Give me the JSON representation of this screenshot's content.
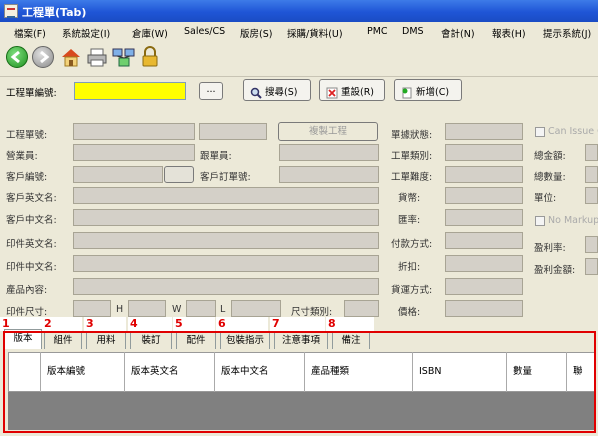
{
  "window": {
    "title": "工程單(Tab)"
  },
  "menu": [
    "檔案(F)",
    "系統設定(I)",
    "倉庫(W)",
    "Sales/CS",
    "版房(S)",
    "採購/貨料(U)",
    "PMC",
    "DMS",
    "會計(N)",
    "報表(H)",
    "提示系統(J)"
  ],
  "toolbar": {
    "icons": [
      "back-icon",
      "forward-icon",
      "home-icon",
      "print-icon",
      "network-icon",
      "lock-icon"
    ]
  },
  "search": {
    "label": "工程單編號:",
    "value": "",
    "browse_label": "...",
    "search_button": "搜尋(S)",
    "reset_button": "重設(R)",
    "new_button": "新增(C)"
  },
  "form": {
    "job_no_label": "工程單號:",
    "copy_job_button": "複製工程",
    "sales_label": "營業員:",
    "follower_label": "跟單員:",
    "customer_code_label": "客戶編號:",
    "customer_order_label": "客戶訂單號:",
    "customer_en_label": "客戶英文名:",
    "customer_cn_label": "客戶中文名:",
    "print_en_label": "印件英文名:",
    "print_cn_label": "印件中文名:",
    "product_content_label": "產品內容:",
    "print_size_label": "印件尺寸:",
    "size_h": "H",
    "size_w": "W",
    "size_l": "L",
    "size_type_label": "尺寸類別:",
    "order_status_label": "單據狀態:",
    "job_type_label": "工單類別:",
    "job_difficulty_label": "工單難度:",
    "currency_label": "貨幣:",
    "exchange_rate_label": "匯率:",
    "payment_label": "付款方式:",
    "discount_label": "折扣:",
    "delivery_label": "貨運方式:",
    "price_label": "價格:",
    "can_issue_label": "Can Issue C",
    "total_amount_label": "總金額:",
    "total_qty_label": "總數量:",
    "unit_label": "單位:",
    "no_markup_label": "No Markup",
    "profit_rate_label": "盈利率:",
    "profit_amount_label": "盈利金額:"
  },
  "tabs": [
    "版本",
    "組件",
    "用料",
    "裝訂",
    "配件",
    "包裝指示",
    "注意事項",
    "備注"
  ],
  "tab_numbers": [
    "1",
    "2",
    "3",
    "4",
    "5",
    "6",
    "7",
    "8"
  ],
  "grid": {
    "columns": [
      "版本編號",
      "版本英文名",
      "版本中文名",
      "產品種類",
      "ISBN",
      "數量",
      "聯"
    ]
  },
  "colors": {
    "highlight_red": "#e00000",
    "title_blue": "#1f55d6",
    "search_field_yellow": "#ffff00"
  }
}
